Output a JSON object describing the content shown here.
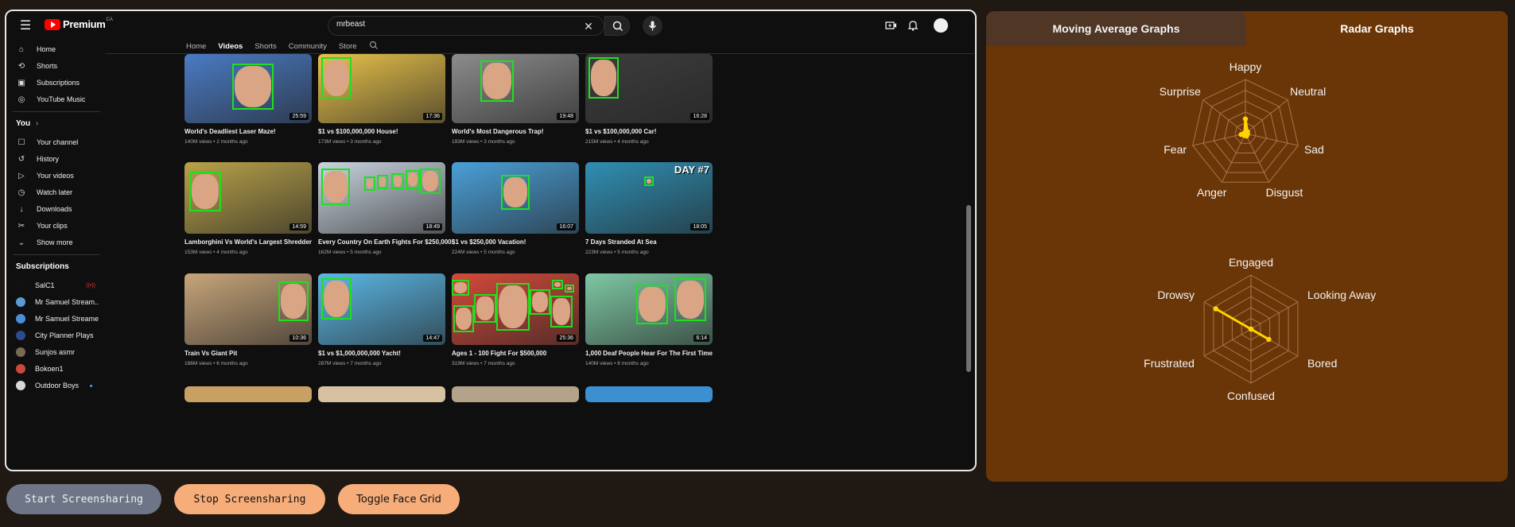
{
  "youtube": {
    "premium_word": "Premium",
    "premium_region": "CA",
    "search_value": "mrbeast",
    "sidebar": {
      "main": [
        {
          "label": "Home",
          "icon": "home-icon"
        },
        {
          "label": "Shorts",
          "icon": "shorts-icon"
        },
        {
          "label": "Subscriptions",
          "icon": "subscriptions-icon"
        },
        {
          "label": "YouTube Music",
          "icon": "music-icon"
        }
      ],
      "you_heading": "You",
      "you": [
        {
          "label": "Your channel"
        },
        {
          "label": "History"
        },
        {
          "label": "Your videos"
        },
        {
          "label": "Watch later"
        },
        {
          "label": "Downloads"
        },
        {
          "label": "Your clips"
        },
        {
          "label": "Show more"
        }
      ],
      "subs_heading": "Subscriptions",
      "subscriptions": [
        {
          "label": "SalC1",
          "color": "#111111"
        },
        {
          "label": "Mr Samuel Stream...",
          "color": "#5b9bd5"
        },
        {
          "label": "Mr Samuel Streamer",
          "color": "#4a8ed8"
        },
        {
          "label": "City Planner Plays",
          "color": "#2d4c8a"
        },
        {
          "label": "Sunjos asmr",
          "color": "#7a6a55"
        },
        {
          "label": "Bokoen1",
          "color": "#c84a3c"
        },
        {
          "label": "Outdoor Boys",
          "color": "#d8d8d8"
        }
      ]
    },
    "tabs": [
      "Home",
      "Videos",
      "Shorts",
      "Community",
      "Store"
    ],
    "videos": [
      {
        "title": "World's Deadliest Laser Maze!",
        "meta": "140M views • 2 months ago",
        "duration": "25:59",
        "bg": "#4a7bc4"
      },
      {
        "title": "$1 vs $100,000,000 House!",
        "meta": "173M views • 3 months ago",
        "duration": "17:36",
        "bg": "#e8c24a"
      },
      {
        "title": "World's Most Dangerous Trap!",
        "meta": "193M views • 3 months ago",
        "duration": "19:48",
        "bg": "#8c8c8c"
      },
      {
        "title": "$1 vs $100,000,000 Car!",
        "meta": "215M views • 4 months ago",
        "duration": "16:28",
        "bg": "#3d3d3d"
      },
      {
        "title": "Lamborghini Vs World's Largest Shredder",
        "meta": "153M views • 4 months ago",
        "duration": "14:59",
        "bg": "#b8a24a"
      },
      {
        "title": "Every Country On Earth Fights For $250,000!",
        "meta": "162M views • 5 months ago",
        "duration": "18:49",
        "bg": "#c9d4df"
      },
      {
        "title": "$1 vs $250,000 Vacation!",
        "meta": "224M views • 5 months ago",
        "duration": "16:07",
        "bg": "#4aa0d8"
      },
      {
        "title": "7 Days Stranded At Sea",
        "meta": "223M views • 5 months ago",
        "duration": "18:05",
        "bg": "#2f8fb4",
        "overlay": "DAY #7"
      },
      {
        "title": "Train Vs Giant Pit",
        "meta": "186M views • 6 months ago",
        "duration": "10:36",
        "bg": "#c7a57a"
      },
      {
        "title": "$1 vs $1,000,000,000 Yacht!",
        "meta": "287M views • 7 months ago",
        "duration": "14:47",
        "bg": "#5bb8e6"
      },
      {
        "title": "Ages 1 - 100 Fight For $500,000",
        "meta": "319M views • 7 months ago",
        "duration": "25:36",
        "bg": "#d44a3a"
      },
      {
        "title": "1,000 Deaf People Hear For The First Time",
        "meta": "140M views • 8 months ago",
        "duration": "6:14",
        "bg": "#7ec8a4"
      }
    ]
  },
  "buttons": {
    "start": "Start Screensharing",
    "stop": "Stop Screensharing",
    "toggle": "Toggle Face Grid"
  },
  "panel": {
    "tab_moving_average": "Moving Average Graphs",
    "tab_radar": "Radar Graphs",
    "accent": "#ffd400",
    "radar_emotions": {
      "axes": [
        "Happy",
        "Neutral",
        "Sad",
        "Disgust",
        "Anger",
        "Fear",
        "Surprise"
      ],
      "values": [
        0.27,
        0.05,
        0.04,
        0.05,
        0.04,
        0.08,
        0.02
      ]
    },
    "radar_attention": {
      "axes": [
        "Engaged",
        "Looking Away",
        "Bored",
        "Confused",
        "Frustrated",
        "Drowsy"
      ],
      "values": [
        0.0,
        0.0,
        0.38,
        0.0,
        0.0,
        0.75
      ]
    }
  }
}
